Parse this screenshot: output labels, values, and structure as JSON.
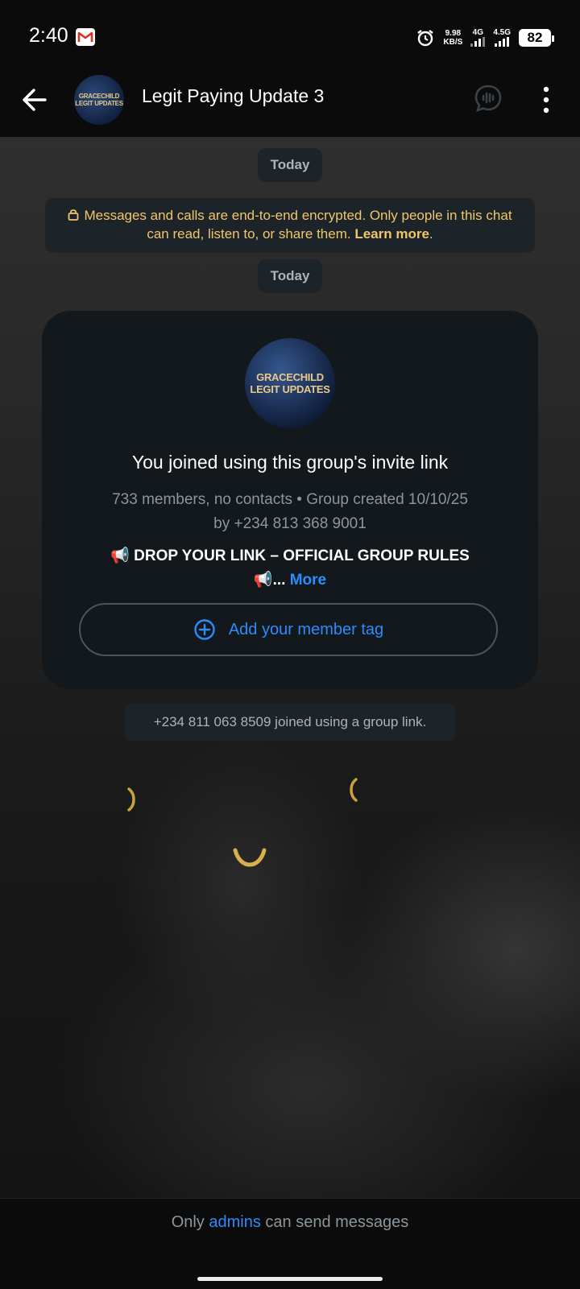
{
  "status_bar": {
    "time": "2:40",
    "speed_value": "9.98",
    "speed_unit": "KB/S",
    "net1": "4G",
    "net2": "4.5G",
    "battery": "82"
  },
  "header": {
    "title": "Legit Paying Update 3",
    "avatar_text_line1": "GRACECHILD",
    "avatar_text_line2": "LEGIT UPDATES"
  },
  "chat": {
    "date_chip_1": "Today",
    "encryption": {
      "text": "Messages and calls are end-to-end encrypted. Only people in this chat can read, listen to, or share them.",
      "link": "Learn more",
      "suffix": "."
    },
    "date_chip_2": "Today",
    "invite_card": {
      "avatar_line1": "GRACECHILD",
      "avatar_line2": "LEGIT UPDATES",
      "title": "You joined using this group's invite link",
      "subtitle": "733 members, no contacts • Group created 10/10/25 by +234 813 368 9001",
      "rules_line1": "📢 DROP YOUR LINK – OFFICIAL GROUP RULES",
      "rules_line2": "📢...",
      "more": "More",
      "button_label": "Add your member tag"
    },
    "join_notice": "+234 811 063 8509 joined using a group link."
  },
  "footer": {
    "prefix": "Only",
    "link": "admins",
    "suffix": "can send messages"
  },
  "colors": {
    "accent_blue": "#2b8cff",
    "encryption_yellow": "#f1c66a",
    "bubble_bg": "#1d2429",
    "card_bg": "#12181c"
  }
}
